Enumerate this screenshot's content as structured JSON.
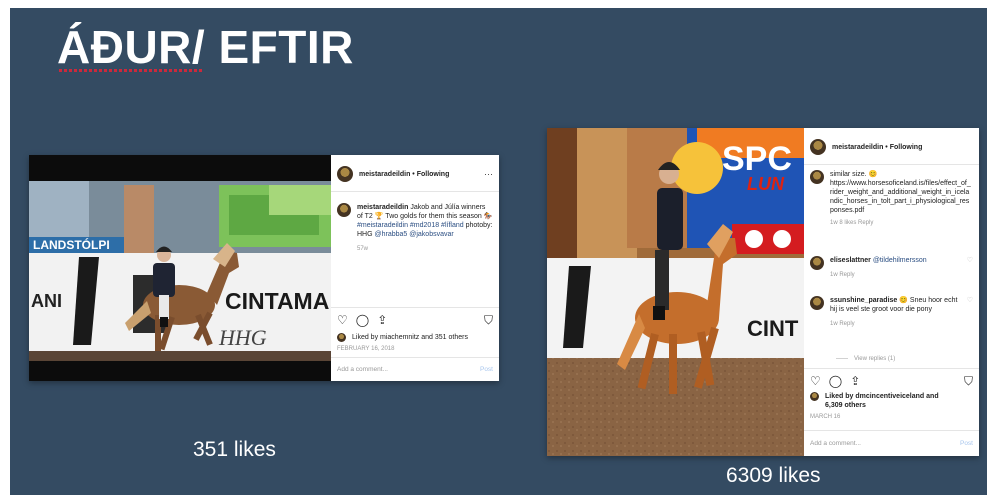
{
  "title": "ÁÐUR/ EFTIR",
  "caption_before": "351 likes",
  "caption_after": "6309 likes",
  "post1": {
    "account": "meistaradeildin • Following",
    "more": "···",
    "caption_user": "meistaradeildin",
    "caption_text": "Jakob and Júlía winners of T2 🏆  Two golds for them this season 🏇",
    "caption_tags": "#meistaradeildin #md2018 #lífland",
    "caption_credit": "photoby: HHG",
    "caption_mentions": "@hrabba5 @jakobsvavar",
    "age": "57w",
    "liked_by": "Liked by miachemnitz and 351 others",
    "date": "FEBRUARY 16, 2018",
    "add_comment": "Add a comment...",
    "post_btn": "Post",
    "banner_left": "LANDSTÓLPI",
    "banner_brand": "CINTAMA",
    "banner_left2": "ANI",
    "watermark": "HHG"
  },
  "post2": {
    "account": "meistaradeildin • Following",
    "comment1_text": "similar size. 😊",
    "comment1_link": "https://www.horsesoficeland.is/files/effect_of_rider_weight_and_additional_weight_in_icelandic_horses_in_tolt_part_i_physiological_responses.pdf",
    "comment1_meta": "1w   8 likes   Reply",
    "comment2_user": "eliseslattner",
    "comment2_mention": "@tildehilmersson",
    "comment2_meta": "1w   Reply",
    "comment3_user": "ssunshine_paradise",
    "comment3_text": "😊 Sneu hoor echt hij is veel ste groot voor die pony",
    "comment3_meta": "1w   Reply",
    "view_replies": "View replies (1)",
    "liked_by": "Liked by dmcincentiveiceland and",
    "liked_count": "6,309 others",
    "date": "MARCH 16",
    "add_comment": "Add a comment...",
    "post_btn": "Post",
    "banner_sponsor": "SPC",
    "banner_sponsor2": "LUN",
    "banner_brand": "CINT"
  },
  "colors": {
    "slide_bg": "#344b62",
    "link": "#2b4e82"
  },
  "icons": [
    "heart-icon",
    "comment-icon",
    "share-icon",
    "bookmark-icon"
  ]
}
